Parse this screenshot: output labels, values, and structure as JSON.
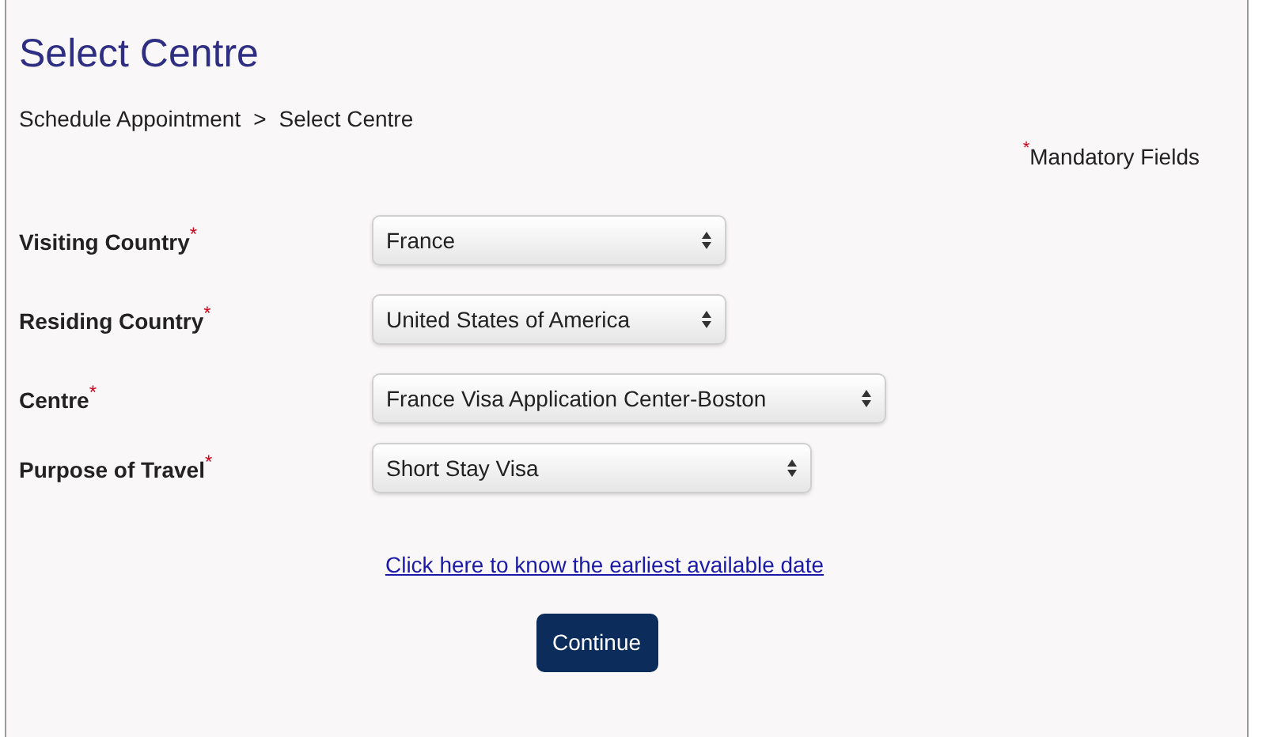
{
  "title": "Select Centre",
  "breadcrumb": {
    "items": [
      "Schedule Appointment",
      "Select Centre"
    ],
    "separator": ">"
  },
  "mandatory_note": {
    "mark": "*",
    "text": "Mandatory Fields"
  },
  "fields": [
    {
      "label": "Visiting Country",
      "mark": "*",
      "value": "France"
    },
    {
      "label": "Residing Country",
      "mark": "*",
      "value": "United States of America"
    },
    {
      "label": "Centre",
      "mark": "*",
      "value": "France Visa Application Center-Boston"
    },
    {
      "label": "Purpose of Travel",
      "mark": "*",
      "value": "Short Stay Visa"
    }
  ],
  "link": "Click here to know the earliest available date",
  "button": "Continue"
}
